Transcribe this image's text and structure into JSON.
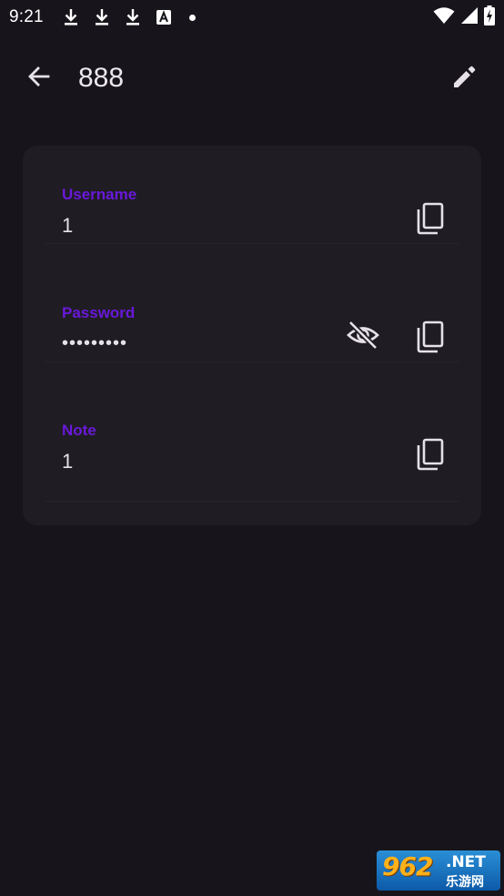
{
  "status_bar": {
    "time": "9:21",
    "left_icons": [
      "download-icon",
      "download-icon",
      "download-icon",
      "font-a-icon",
      "dot-icon"
    ],
    "right_icons": [
      "wifi-icon",
      "cell-signal-icon",
      "battery-charging-icon"
    ]
  },
  "app_bar": {
    "title": "888",
    "back_icon": "arrow-left-icon",
    "edit_icon": "pencil-icon"
  },
  "fields": [
    {
      "label": "Username",
      "value": "1",
      "actions": [
        "copy-icon"
      ]
    },
    {
      "label": "Password",
      "value": "•••••••••",
      "actions": [
        "eye-off-icon",
        "copy-icon"
      ]
    },
    {
      "label": "Note",
      "value": "1",
      "actions": [
        "copy-icon"
      ]
    }
  ],
  "watermark": {
    "number": "962",
    "suffix": ".NET",
    "subtitle": "乐游网"
  },
  "colors": {
    "background": "#17151b",
    "card": "#1f1d23",
    "label_accent": "#6a18d9",
    "text": "#e6e1e8"
  }
}
